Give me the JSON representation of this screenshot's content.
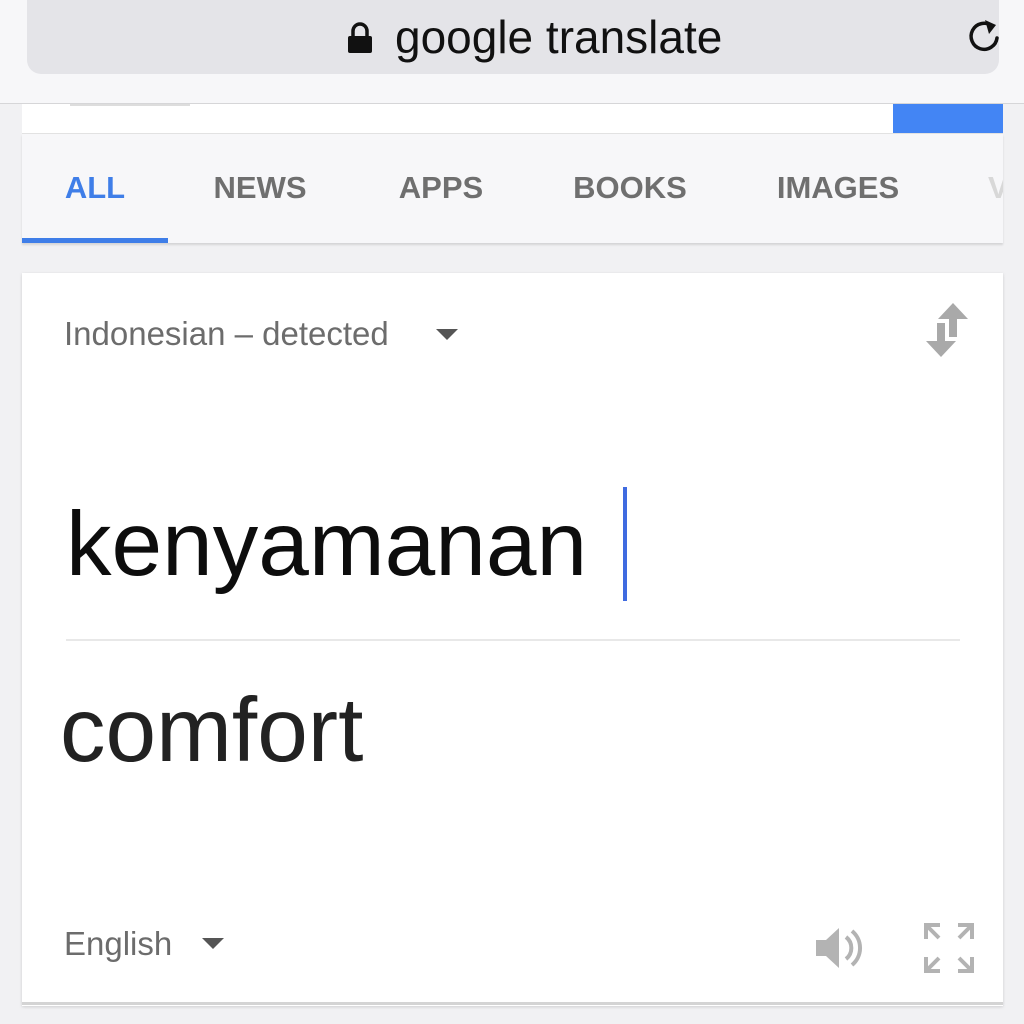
{
  "browser": {
    "url_text": "google translate",
    "lock_icon": "lock-icon",
    "reload_icon": "reload-icon"
  },
  "tabs": [
    {
      "label": "ALL",
      "active": true
    },
    {
      "label": "NEWS",
      "active": false
    },
    {
      "label": "APPS",
      "active": false
    },
    {
      "label": "BOOKS",
      "active": false
    },
    {
      "label": "IMAGES",
      "active": false
    },
    {
      "label": "V",
      "active": false
    }
  ],
  "translate": {
    "source_language": "Indonesian – detected",
    "input_text": "kenyamanan",
    "output_text": "comfort",
    "target_language": "English"
  },
  "colors": {
    "accent": "#3f7ee8",
    "search_button": "#4385f4"
  }
}
